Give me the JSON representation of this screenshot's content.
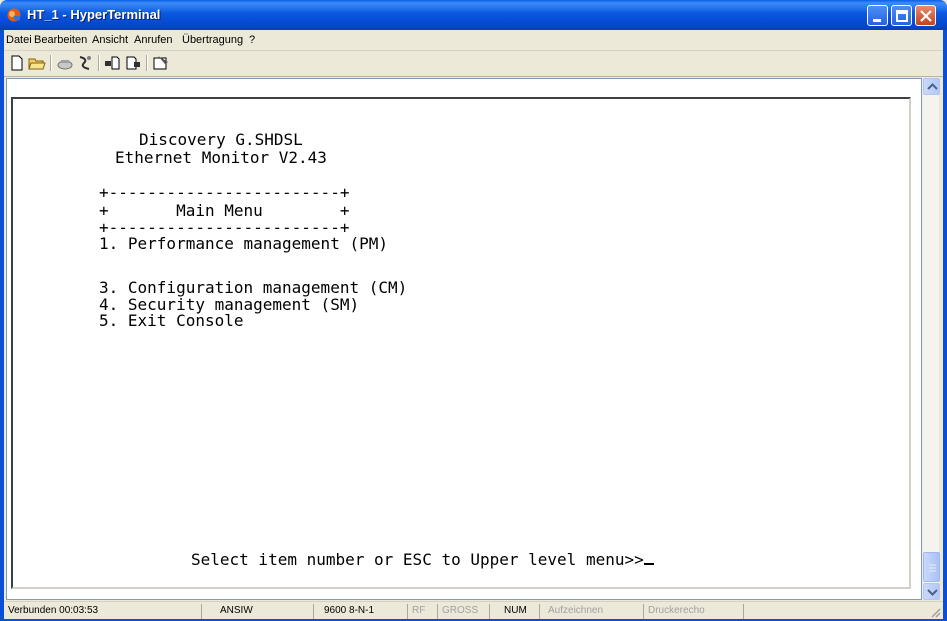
{
  "window": {
    "title": "HT_1 - HyperTerminal",
    "accent": "#0A5DE8"
  },
  "menu": {
    "items": [
      {
        "label": "Datei"
      },
      {
        "label": "Bearbeiten"
      },
      {
        "label": "Ansicht"
      },
      {
        "label": "Anrufen"
      },
      {
        "label": "Übertragung"
      },
      {
        "label": "?"
      }
    ]
  },
  "toolbar": {
    "buttons": [
      {
        "icon": "new-document-icon"
      },
      {
        "icon": "open-folder-icon"
      },
      {
        "icon": "connect-phone-icon"
      },
      {
        "icon": "disconnect-icon"
      },
      {
        "icon": "send-file-icon"
      },
      {
        "icon": "receive-file-icon"
      },
      {
        "icon": "properties-icon"
      }
    ]
  },
  "terminal": {
    "lines": [
      "Discovery G.SHDSL",
      "Ethernet Monitor V2.43",
      "+------------------------+",
      "+       Main Menu        +",
      "+------------------------+",
      "1. Performance management (PM)",
      "3. Configuration management (CM)",
      "4. Security management (SM)",
      "5. Exit Console",
      "Select item number or ESC to Upper level menu>>"
    ]
  },
  "status": {
    "connected": "Verbunden 00:03:53",
    "emulation": "ANSIW",
    "port": "9600 8-N-1",
    "rf": "RF",
    "caps": "GROSS",
    "num": "NUM",
    "capture": "Aufzeichnen",
    "print_echo": "Druckerecho"
  }
}
